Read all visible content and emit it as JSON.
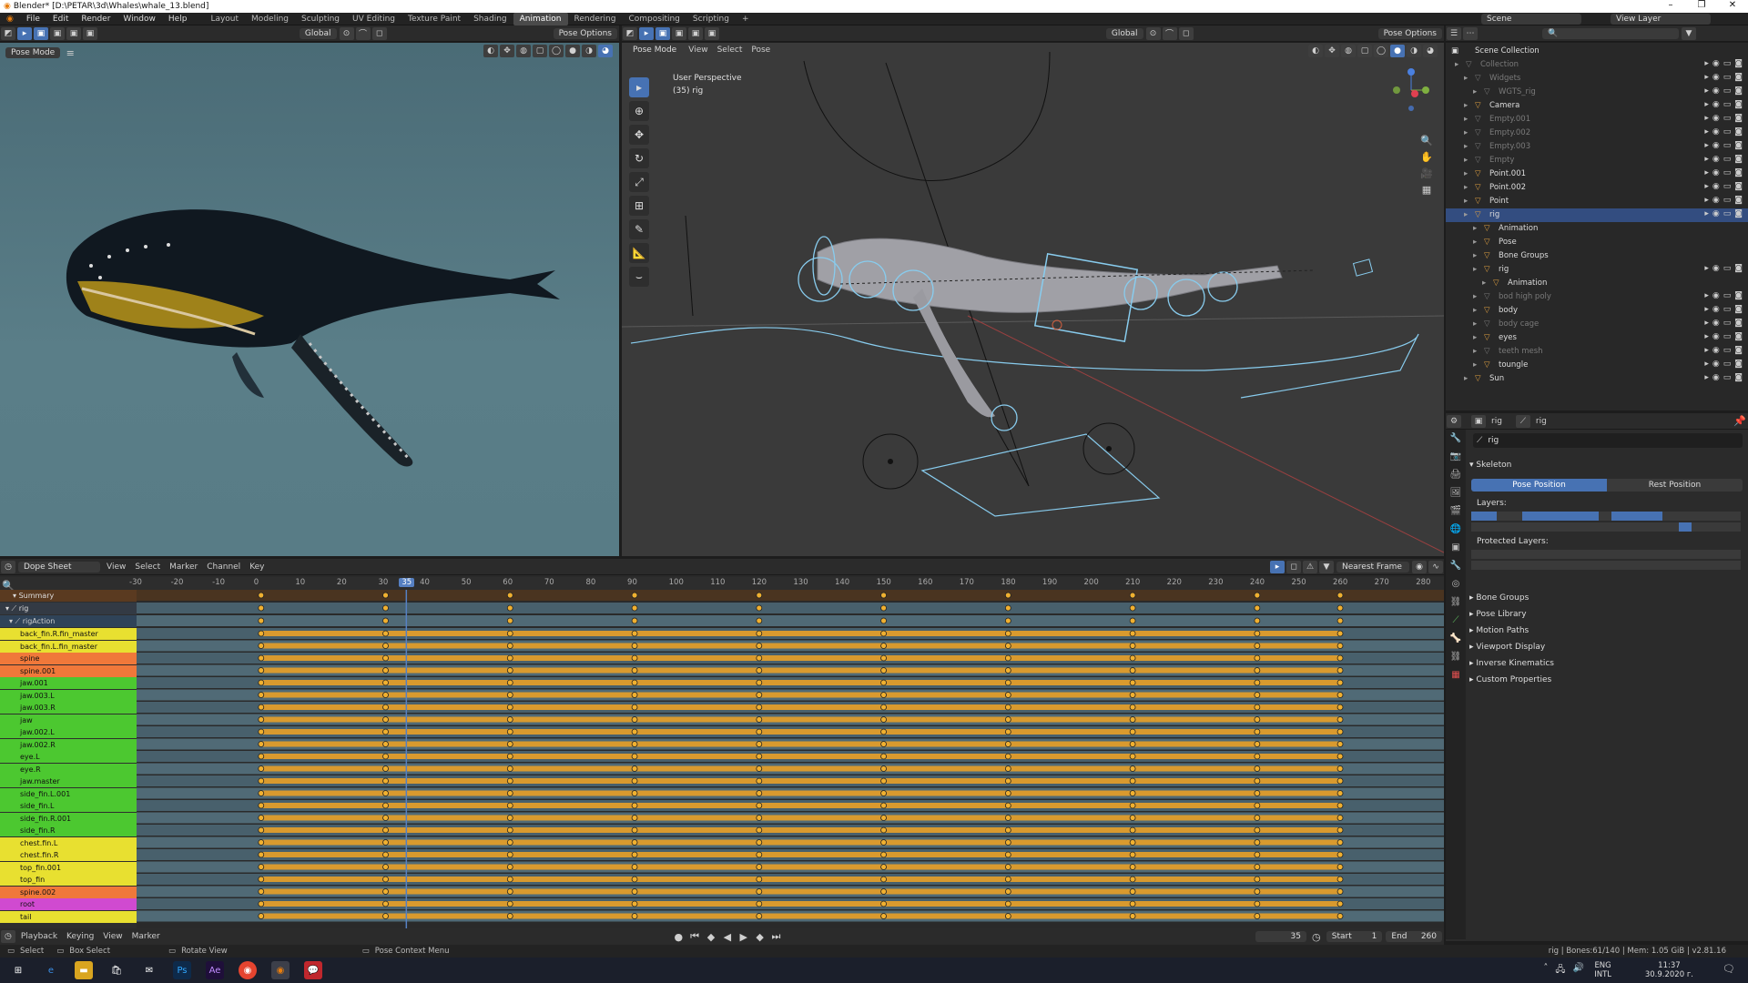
{
  "title_bar": {
    "text": "Blender* [D:\\PETAR\\3d\\Whales\\whale_13.blend]"
  },
  "menu": [
    "File",
    "Edit",
    "Render",
    "Window",
    "Help"
  ],
  "workspaces": [
    "Layout",
    "Modeling",
    "Sculpting",
    "UV Editing",
    "Texture Paint",
    "Shading",
    "Animation",
    "Rendering",
    "Compositing",
    "Scripting"
  ],
  "active_workspace": "Animation",
  "scene": {
    "label": "Scene",
    "view_layer": "View Layer"
  },
  "left_view": {
    "mode": "Pose Mode",
    "transform": "Global",
    "pose_options": "Pose Options"
  },
  "main_view": {
    "mode": "Pose Mode",
    "menus": [
      "View",
      "Select",
      "Pose"
    ],
    "transform": "Global",
    "pose_options": "Pose Options",
    "perspective": "User Perspective",
    "frame_info": "(35) rig"
  },
  "outliner": {
    "title": "Scene Collection",
    "rows": [
      {
        "name": "Collection",
        "dim": true,
        "indent": 1
      },
      {
        "name": "Widgets",
        "dim": true,
        "indent": 2
      },
      {
        "name": "WGTS_rig",
        "dim": true,
        "indent": 3
      },
      {
        "name": "Camera",
        "dim": false,
        "indent": 2
      },
      {
        "name": "Empty.001",
        "dim": true,
        "indent": 2
      },
      {
        "name": "Empty.002",
        "dim": true,
        "indent": 2
      },
      {
        "name": "Empty.003",
        "dim": true,
        "indent": 2
      },
      {
        "name": "Empty",
        "dim": true,
        "indent": 2
      },
      {
        "name": "Point.001",
        "dim": false,
        "indent": 2
      },
      {
        "name": "Point.002",
        "dim": false,
        "indent": 2
      },
      {
        "name": "Point",
        "dim": false,
        "indent": 2
      },
      {
        "name": "rig",
        "dim": false,
        "indent": 2,
        "selected": true
      },
      {
        "name": "Animation",
        "dim": false,
        "indent": 3
      },
      {
        "name": "Pose",
        "dim": false,
        "indent": 3
      },
      {
        "name": "Bone Groups",
        "dim": false,
        "indent": 3
      },
      {
        "name": "rig",
        "dim": false,
        "indent": 3
      },
      {
        "name": "Animation",
        "dim": false,
        "indent": 4
      },
      {
        "name": "bod high poly",
        "dim": true,
        "indent": 3
      },
      {
        "name": "body",
        "dim": false,
        "indent": 3
      },
      {
        "name": "body cage",
        "dim": true,
        "indent": 3
      },
      {
        "name": "eyes",
        "dim": false,
        "indent": 3
      },
      {
        "name": "teeth mesh",
        "dim": true,
        "indent": 3
      },
      {
        "name": "toungle",
        "dim": false,
        "indent": 3
      },
      {
        "name": "Sun",
        "dim": false,
        "indent": 2
      }
    ]
  },
  "properties": {
    "breadcrumb": [
      "rig",
      "rig"
    ],
    "object_name": "rig",
    "skeleton_label": "Skeleton",
    "pose_position": "Pose Position",
    "rest_position": "Rest Position",
    "layers_label": "Layers:",
    "protected_layers_label": "Protected Layers:",
    "sections": [
      "Bone Groups",
      "Pose Library",
      "Motion Paths",
      "Viewport Display",
      "Inverse Kinematics",
      "Custom Properties"
    ]
  },
  "dope_sheet": {
    "editor": "Dope Sheet",
    "menus": [
      "View",
      "Select",
      "Marker",
      "Channel",
      "Key"
    ],
    "snap": "Nearest Frame",
    "ticks": [
      "-30",
      "-20",
      "-10",
      "0",
      "10",
      "20",
      "30",
      "35",
      "40",
      "50",
      "60",
      "70",
      "80",
      "90",
      "100",
      "110",
      "120",
      "130",
      "140",
      "150",
      "160",
      "170",
      "180",
      "190",
      "200",
      "210",
      "220",
      "230",
      "240",
      "250",
      "260",
      "270",
      "280"
    ],
    "current_frame": "35",
    "summary": "Summary",
    "object": "rig",
    "action": "rigAction",
    "channels": [
      {
        "name": "back_fin.R.fin_master",
        "color": "#e8e030"
      },
      {
        "name": "back_fin.L.fin_master",
        "color": "#e8e030"
      },
      {
        "name": "spine",
        "color": "#f0783a"
      },
      {
        "name": "spine.001",
        "color": "#f0783a"
      },
      {
        "name": "jaw.001",
        "color": "#4cc830"
      },
      {
        "name": "jaw.003.L",
        "color": "#4cc830"
      },
      {
        "name": "jaw.003.R",
        "color": "#4cc830"
      },
      {
        "name": "jaw",
        "color": "#4cc830"
      },
      {
        "name": "jaw.002.L",
        "color": "#4cc830"
      },
      {
        "name": "jaw.002.R",
        "color": "#4cc830"
      },
      {
        "name": "eye.L",
        "color": "#4cc830"
      },
      {
        "name": "eye.R",
        "color": "#4cc830"
      },
      {
        "name": "jaw.master",
        "color": "#4cc830"
      },
      {
        "name": "side_fin.L.001",
        "color": "#4cc830"
      },
      {
        "name": "side_fin.L",
        "color": "#4cc830"
      },
      {
        "name": "side_fin.R.001",
        "color": "#4cc830"
      },
      {
        "name": "side_fin.R",
        "color": "#4cc830"
      },
      {
        "name": "chest.fin.L",
        "color": "#e8e030"
      },
      {
        "name": "chest.fin.R",
        "color": "#e8e030"
      },
      {
        "name": "top_fin.001",
        "color": "#e8e030"
      },
      {
        "name": "top_fin",
        "color": "#e8e030"
      },
      {
        "name": "spine.002",
        "color": "#f0783a"
      },
      {
        "name": "root",
        "color": "#d04ad0"
      },
      {
        "name": "tail",
        "color": "#e8e030"
      }
    ]
  },
  "timeline": {
    "menus": [
      "Playback",
      "Keying",
      "View",
      "Marker"
    ],
    "frame": "35",
    "start_label": "Start",
    "start": "1",
    "end_label": "End",
    "end": "260"
  },
  "status_bar": {
    "select": "Select",
    "box_select": "Box Select",
    "rotate": "Rotate View",
    "context": "Pose Context Menu",
    "stats": "rig | Bones:61/140 | Mem: 1.05 GiB | v2.81.16"
  },
  "taskbar": {
    "lang": "ENG",
    "region": "INTL",
    "time": "11:37",
    "date": "30.9.2020 г."
  },
  "colors": {
    "accent": "#4772b3",
    "key": "#f0b030",
    "hold": "#d99a2e",
    "playhead": "#5680c2"
  }
}
